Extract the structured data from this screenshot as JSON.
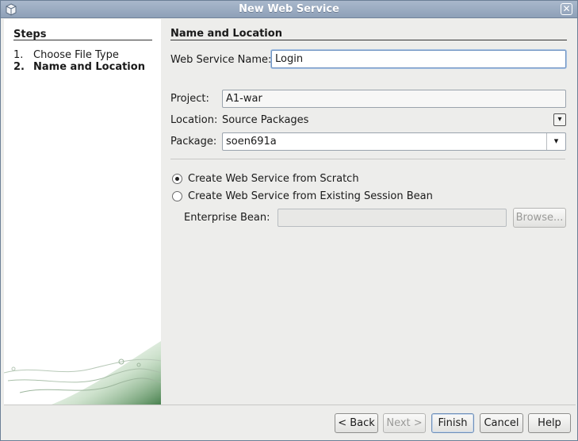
{
  "window": {
    "title": "New Web Service"
  },
  "steps": {
    "heading": "Steps",
    "items": [
      {
        "num": "1.",
        "label": "Choose File Type"
      },
      {
        "num": "2.",
        "label": "Name and Location"
      }
    ]
  },
  "form": {
    "section_title": "Name and Location",
    "service_name_label": "Web Service Name:",
    "service_name_value": "Login",
    "project_label": "Project:",
    "project_value": "A1-war",
    "location_label": "Location:",
    "location_value": "Source Packages",
    "package_label": "Package:",
    "package_value": "soen691a",
    "radio_scratch_label": "Create Web Service from Scratch",
    "radio_session_label": "Create Web Service from Existing Session Bean",
    "enterprise_bean_label": "Enterprise Bean:",
    "enterprise_bean_value": "",
    "browse_label": "Browse...",
    "selected_option": "scratch"
  },
  "buttons": {
    "back": "< Back",
    "next": "Next >",
    "finish": "Finish",
    "cancel": "Cancel",
    "help": "Help"
  },
  "icons": {
    "app": "netbeans-cube-icon",
    "close": "close-icon",
    "combo": "chevron-down-icon"
  }
}
